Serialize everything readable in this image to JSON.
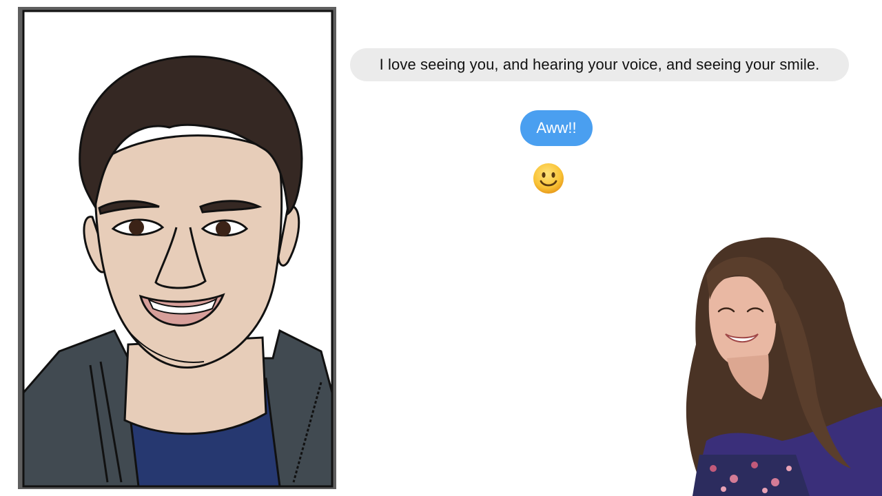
{
  "conversation": {
    "received_message": "I love seeing you, and hearing your voice, and seeing your smile.",
    "sent_message": "Aww!!",
    "reaction_emoji": "smiling-face-emoji"
  },
  "images": {
    "left_portrait": "cartoon-portrait-of-young-man",
    "right_photo": "photo-of-smiling-young-woman"
  },
  "colors": {
    "received_bubble": "#ebebeb",
    "sent_bubble": "#4a9ff0",
    "frame": "#5f5f5f",
    "skin": "#e7cdb9",
    "hair_dark": "#352823",
    "jacket": "#414a51",
    "shirt": "#263870"
  }
}
